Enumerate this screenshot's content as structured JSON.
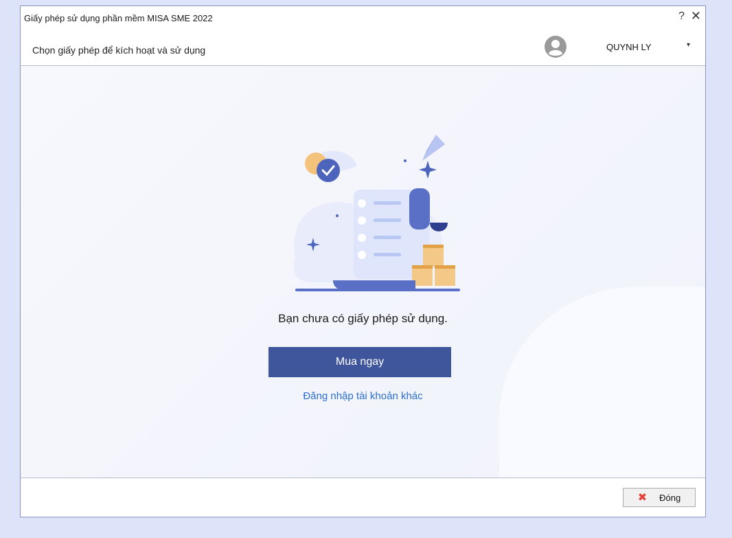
{
  "window": {
    "title": "Giấy phép sử dụng phần mềm MISA SME 2022",
    "help_glyph": "?",
    "close_glyph": "✕"
  },
  "header": {
    "subtitle": "Chọn giấy phép để kích hoạt và sử dụng",
    "user_name": "QUYNH LY",
    "caret_glyph": "▾",
    "avatar_icon": "user-avatar-icon"
  },
  "main": {
    "message": "Bạn chưa có giấy phép sử dụng.",
    "buy_button_label": "Mua ngay",
    "login_link_label": "Đăng nhập tài khoản khác"
  },
  "footer": {
    "close_button_label": "Đóng",
    "close_button_icon": "close-x-icon"
  },
  "colors": {
    "primary": "#3f559c",
    "link": "#2c6fd1",
    "window_bg": "#dde3f8"
  }
}
